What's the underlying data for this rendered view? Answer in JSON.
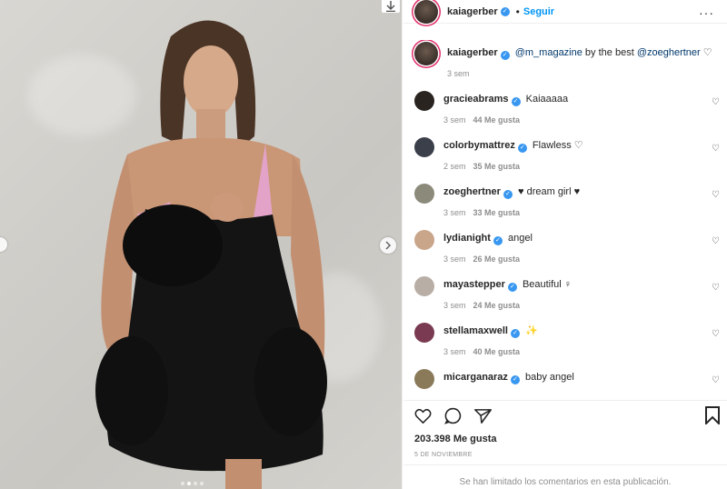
{
  "post": {
    "author": "kaiagerber",
    "follow_separator": "•",
    "follow_label": "Seguir",
    "more_glyph": "···",
    "caption": {
      "username": "kaiagerber",
      "mention1": "@m_magazine",
      "middle_text": " by the best ",
      "mention2": "@zoeghertner",
      "heart": "♡",
      "time": "3 sem"
    },
    "comments": [
      {
        "username": "gracieabrams",
        "text": "Kaiaaaaa",
        "time": "3 sem",
        "likes": "44 Me gusta",
        "avatar_color": "#2a2420"
      },
      {
        "username": "colorbymattrez",
        "text": "Flawless ♡",
        "time": "2 sem",
        "likes": "35 Me gusta",
        "avatar_color": "#3b3f4a"
      },
      {
        "username": "zoeghertner",
        "text": "♥ dream girl ♥",
        "time": "3 sem",
        "likes": "33 Me gusta",
        "avatar_color": "#8c8a7a"
      },
      {
        "username": "lydianight",
        "text": "angel",
        "time": "3 sem",
        "likes": "26 Me gusta",
        "avatar_color": "#c9a58a"
      },
      {
        "username": "mayastepper",
        "text": "Beautiful ♀",
        "time": "3 sem",
        "likes": "24 Me gusta",
        "avatar_color": "#b8aea6"
      },
      {
        "username": "stellamaxwell",
        "text": "✨",
        "time": "3 sem",
        "likes": "40 Me gusta",
        "avatar_color": "#7a3a52"
      },
      {
        "username": "micarganaraz",
        "text": "baby angel",
        "time": "",
        "likes": "",
        "avatar_color": "#8a7a5a"
      }
    ],
    "likes_total": "203.398 Me gusta",
    "date": "5 DE NOVIEMBRE",
    "comments_limited": "Se han limitado los comentarios en esta publicación.",
    "verified_mark": "✓",
    "comment_heart": "♡"
  },
  "colors": {
    "link": "#0095f6",
    "verified": "#3897f0",
    "muted": "#8e8e8e"
  },
  "icons": [
    "download-arrow-icon",
    "chevron-right-icon",
    "heart-icon",
    "comment-icon",
    "share-icon",
    "bookmark-icon"
  ]
}
